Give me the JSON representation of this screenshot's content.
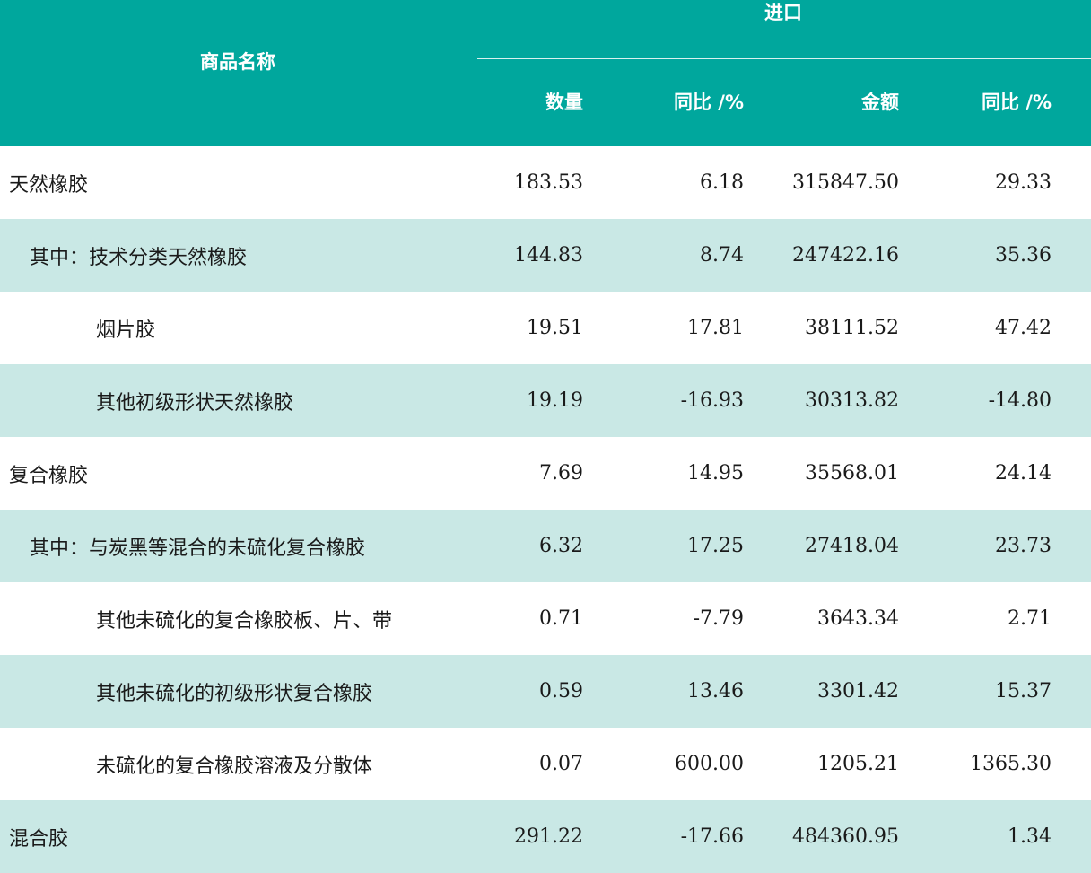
{
  "table": {
    "header": {
      "name_label": "商品名称",
      "group_label": "进口",
      "columns": [
        "数量",
        "同比 /%",
        "金额",
        "同比 /%"
      ]
    },
    "rows": [
      {
        "name": "天然橡胶",
        "level": 0,
        "shade": false,
        "qty": "183.53",
        "qty_yoy": "6.18",
        "amount": "315847.50",
        "amount_yoy": "29.33"
      },
      {
        "name": "其中：技术分类天然橡胶",
        "level": 1,
        "shade": true,
        "qty": "144.83",
        "qty_yoy": "8.74",
        "amount": "247422.16",
        "amount_yoy": "35.36"
      },
      {
        "name": "烟片胶",
        "level": 2,
        "shade": false,
        "qty": "19.51",
        "qty_yoy": "17.81",
        "amount": "38111.52",
        "amount_yoy": "47.42"
      },
      {
        "name": "其他初级形状天然橡胶",
        "level": 2,
        "shade": true,
        "qty": "19.19",
        "qty_yoy": "-16.93",
        "amount": "30313.82",
        "amount_yoy": "-14.80"
      },
      {
        "name": "复合橡胶",
        "level": 0,
        "shade": false,
        "qty": "7.69",
        "qty_yoy": "14.95",
        "amount": "35568.01",
        "amount_yoy": "24.14"
      },
      {
        "name": "其中：与炭黑等混合的未硫化复合橡胶",
        "level": 1,
        "shade": true,
        "qty": "6.32",
        "qty_yoy": "17.25",
        "amount": "27418.04",
        "amount_yoy": "23.73"
      },
      {
        "name": "其他未硫化的复合橡胶板、片、带",
        "level": 2,
        "shade": false,
        "qty": "0.71",
        "qty_yoy": "-7.79",
        "amount": "3643.34",
        "amount_yoy": "2.71"
      },
      {
        "name": "其他未硫化的初级形状复合橡胶",
        "level": 2,
        "shade": true,
        "qty": "0.59",
        "qty_yoy": "13.46",
        "amount": "3301.42",
        "amount_yoy": "15.37"
      },
      {
        "name": "未硫化的复合橡胶溶液及分散体",
        "level": 2,
        "shade": false,
        "qty": "0.07",
        "qty_yoy": "600.00",
        "amount": "1205.21",
        "amount_yoy": "1365.30"
      },
      {
        "name": "混合胶",
        "level": 0,
        "shade": true,
        "qty": "291.22",
        "qty_yoy": "-17.66",
        "amount": "484360.95",
        "amount_yoy": "1.34"
      }
    ]
  },
  "colors": {
    "header_bg": "#00A79D",
    "stripe_bg": "#C9E8E5",
    "header_text": "#ffffff",
    "body_text": "#1a1a1a"
  }
}
